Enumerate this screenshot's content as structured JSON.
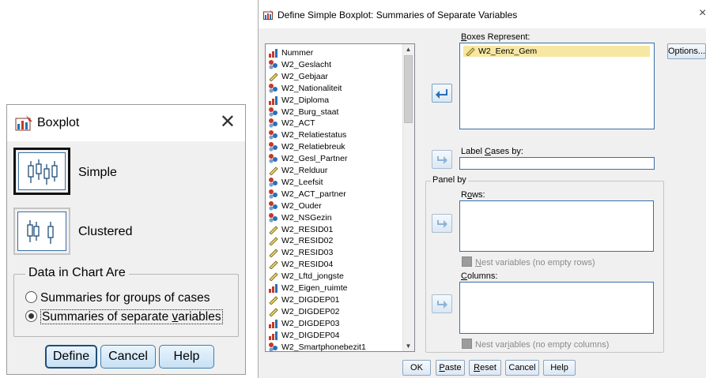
{
  "boxplot_dialog": {
    "title": "Boxplot",
    "close_glyph": "✕",
    "chart_types": [
      {
        "label": "Simple",
        "selected": true,
        "icon": "simple-boxplot-icon"
      },
      {
        "label": "Clustered",
        "selected": false,
        "icon": "clustered-boxplot-icon"
      }
    ],
    "group_title": "Data in Chart Are",
    "radio_options": [
      {
        "label_pre": "Summaries for ",
        "label_u": "g",
        "label_post": "roups of cases",
        "checked": false
      },
      {
        "label_pre": "Summaries of separate ",
        "label_u": "v",
        "label_post": "ariables",
        "checked": true
      }
    ],
    "buttons": {
      "define": "Define",
      "cancel": "Cancel",
      "help": "Help"
    }
  },
  "define_dialog": {
    "title": "Define Simple Boxplot: Summaries of Separate Variables",
    "close_glyph": "×",
    "variables": [
      {
        "name": "Nummer",
        "type": "ordinal"
      },
      {
        "name": "W2_Geslacht",
        "type": "nominal"
      },
      {
        "name": "W2_Gebjaar",
        "type": "scale"
      },
      {
        "name": "W2_Nationaliteit",
        "type": "nominal"
      },
      {
        "name": "W2_Diploma",
        "type": "ordinal"
      },
      {
        "name": "W2_Burg_staat",
        "type": "nominal"
      },
      {
        "name": "W2_ACT",
        "type": "nominal"
      },
      {
        "name": "W2_Relatiestatus",
        "type": "nominal"
      },
      {
        "name": "W2_Relatiebreuk",
        "type": "nominal"
      },
      {
        "name": "W2_Gesl_Partner",
        "type": "nominal"
      },
      {
        "name": "W2_Relduur",
        "type": "scale"
      },
      {
        "name": "W2_Leefsit",
        "type": "nominal"
      },
      {
        "name": "W2_ACT_partner",
        "type": "nominal"
      },
      {
        "name": "W2_Ouder",
        "type": "nominal"
      },
      {
        "name": "W2_NSGezin",
        "type": "nominal"
      },
      {
        "name": "W2_RESID01",
        "type": "scale"
      },
      {
        "name": "W2_RESID02",
        "type": "scale"
      },
      {
        "name": "W2_RESID03",
        "type": "scale"
      },
      {
        "name": "W2_RESID04",
        "type": "scale"
      },
      {
        "name": "W2_Lftd_jongste",
        "type": "scale"
      },
      {
        "name": "W2_Eigen_ruimte",
        "type": "ordinal"
      },
      {
        "name": "W2_DIGDEP01",
        "type": "scale"
      },
      {
        "name": "W2_DIGDEP02",
        "type": "scale"
      },
      {
        "name": "W2_DIGDEP03",
        "type": "ordinal"
      },
      {
        "name": "W2_DIGDEP04",
        "type": "ordinal"
      },
      {
        "name": "W2_Smartphonebezit1",
        "type": "nominal"
      }
    ],
    "boxes_represent_label_u": "B",
    "boxes_represent_label_rest": "oxes Represent:",
    "boxes_represent_item": "W2_Eenz_Gem",
    "label_cases_u": "C",
    "label_cases_pre": "Label ",
    "label_cases_post": "ases by:",
    "panel_by": "Panel by",
    "rows_pre": "R",
    "rows_u": "o",
    "rows_post": "ws:",
    "nest_rows_u": "N",
    "nest_rows_rest": "est variables (no empty rows)",
    "columns_u": "C",
    "columns_post": "olumns:",
    "nest_cols_pre": "Nest var",
    "nest_cols_u": "i",
    "nest_cols_post": "ables (no empty columns)",
    "options_button": "Options...",
    "buttons": {
      "ok": "OK",
      "paste_u": "P",
      "paste_rest": "aste",
      "reset_u": "R",
      "reset_rest": "eset",
      "cancel": "Cancel",
      "help": "Help"
    }
  },
  "colors": {
    "accent": "#3c7fb1",
    "selection": "#f6e7a3",
    "focus_border": "#3c6ea3"
  }
}
